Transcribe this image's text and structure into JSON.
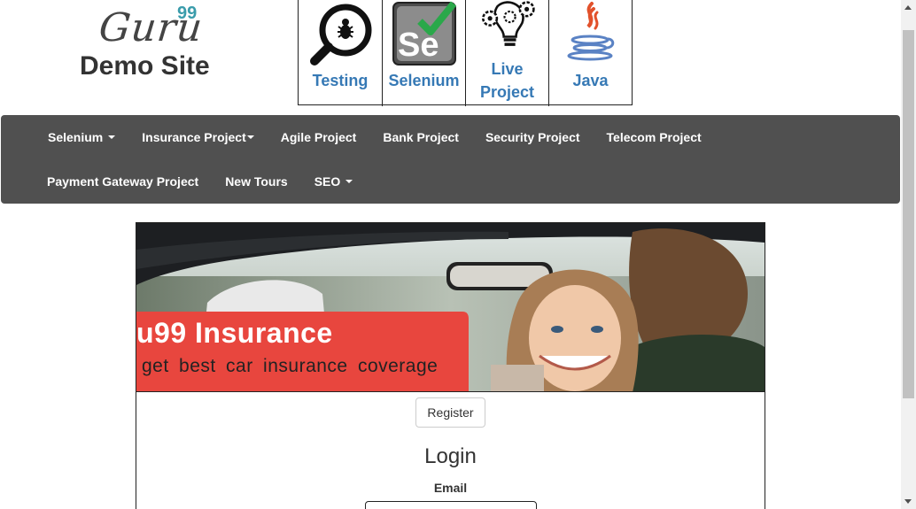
{
  "logo": {
    "guru": "Guru",
    "sup": "99",
    "subtitle": "Demo Site"
  },
  "courses": [
    {
      "label": "Testing",
      "icon": "magnifier-bug-icon"
    },
    {
      "label": "Selenium",
      "icon": "selenium-logo-icon"
    },
    {
      "label": "Live Project",
      "icon": "lightbulb-gears-icon"
    },
    {
      "label": "Java",
      "icon": "java-cup-icon"
    }
  ],
  "nav": {
    "row1": [
      "Selenium",
      "Insurance Project",
      "Agile Project",
      "Bank Project",
      "Security Project",
      "Telecom Project"
    ],
    "row2": [
      "Payment Gateway Project",
      "New Tours",
      "SEO"
    ]
  },
  "banner": {
    "title": "u99 Insurance",
    "subtitle": "get best car insurance coverage"
  },
  "form": {
    "register_label": "Register",
    "heading": "Login",
    "email_label": "Email",
    "email_value": ""
  },
  "colors": {
    "nav_bg": "#505050",
    "link": "#3679b5",
    "accent": "#3a9cab",
    "banner_red": "#e8463e"
  }
}
